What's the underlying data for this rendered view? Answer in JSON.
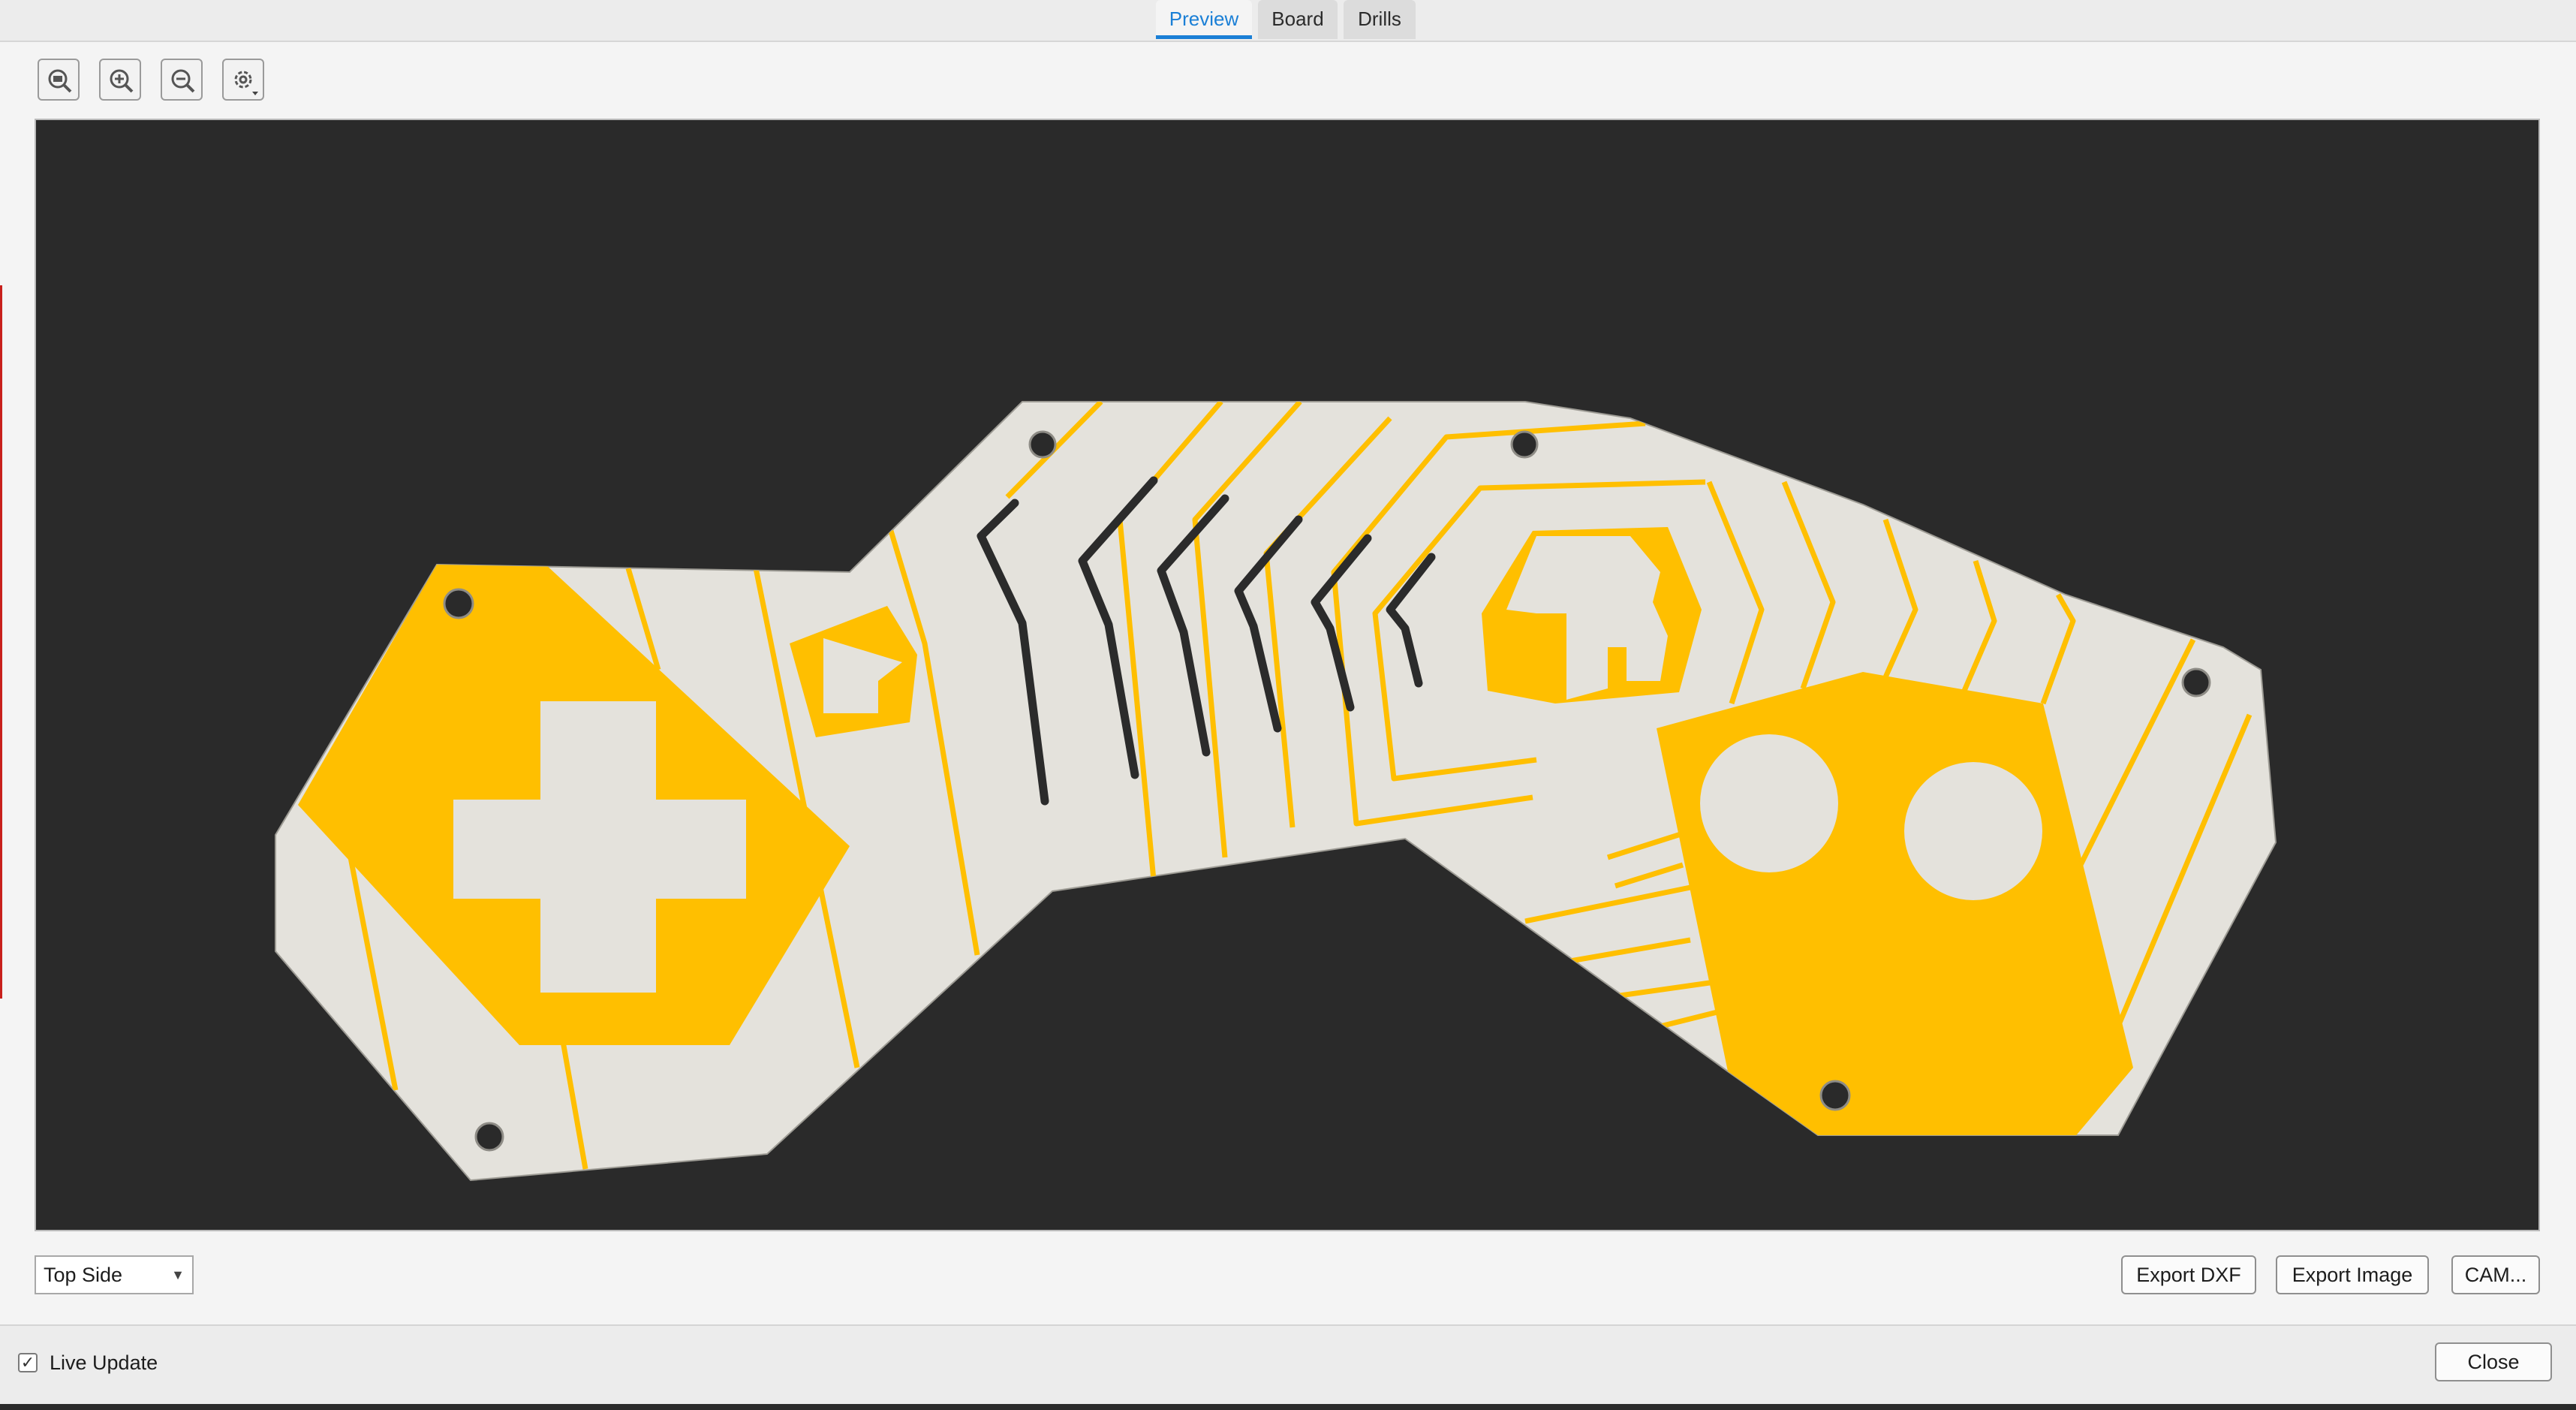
{
  "tabs": [
    {
      "label": "Preview",
      "active": true
    },
    {
      "label": "Board",
      "active": false
    },
    {
      "label": "Drills",
      "active": false
    }
  ],
  "toolbar": {
    "icons": [
      "zoom-fit-icon",
      "zoom-in-icon",
      "zoom-out-icon",
      "settings-icon"
    ]
  },
  "colors": {
    "board": "#e4e2dc",
    "copper": "#ffbf00",
    "background": "#2a2a2a",
    "accent": "#1a7fd6"
  },
  "view": {
    "side": "Top Side"
  },
  "actions": {
    "export_dxf": "Export DXF",
    "export_image": "Export Image",
    "cam": "CAM..."
  },
  "footer": {
    "live_update_label": "Live Update",
    "live_update_checked": true,
    "close": "Close"
  }
}
